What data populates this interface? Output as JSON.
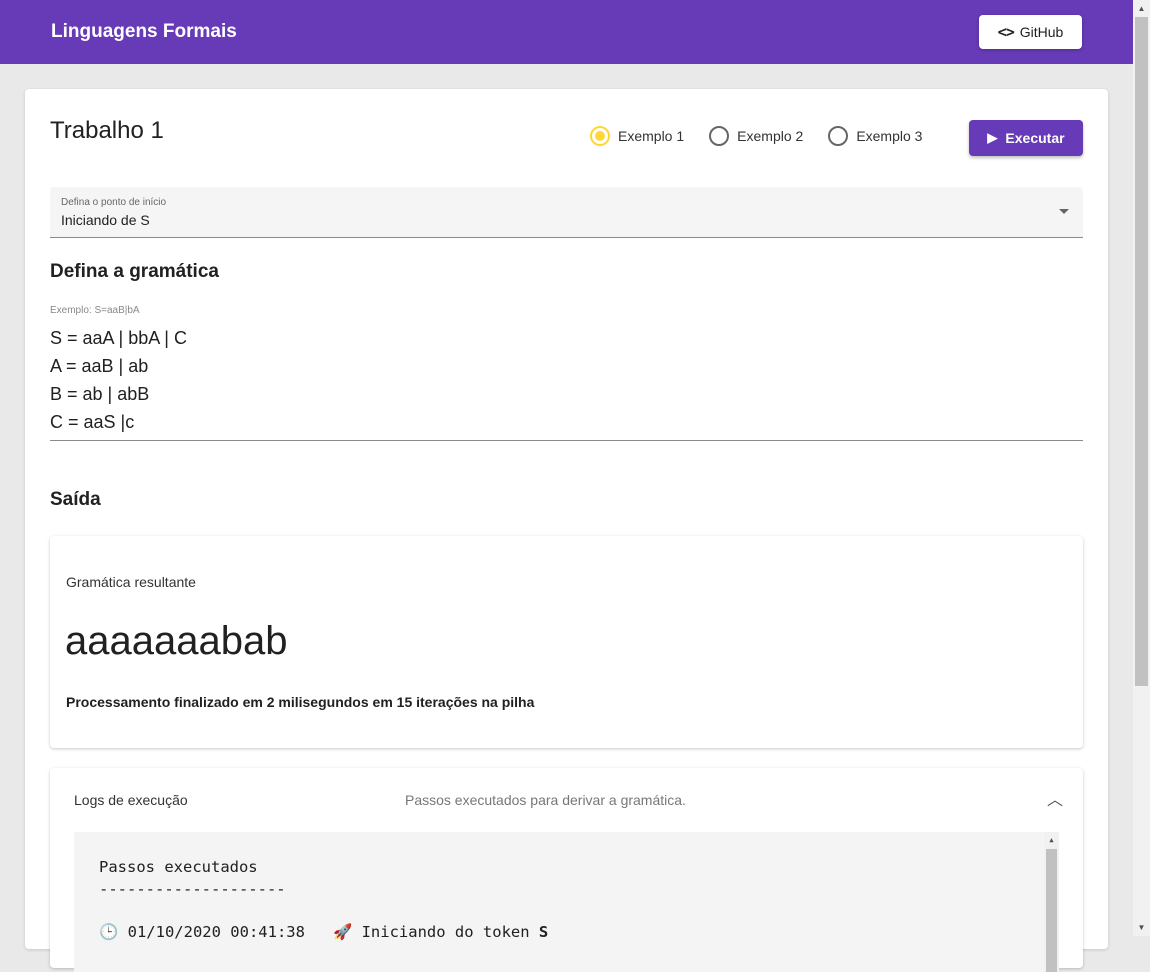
{
  "appbar": {
    "title": "Linguagens Formais",
    "github_label": "GitHub",
    "github_icon": "code-icon"
  },
  "main": {
    "title": "Trabalho 1",
    "examples": [
      {
        "label": "Exemplo 1",
        "checked": true
      },
      {
        "label": "Exemplo 2",
        "checked": false
      },
      {
        "label": "Exemplo 3",
        "checked": false
      }
    ],
    "run_label": "Executar",
    "start_select": {
      "label": "Defina o ponto de início",
      "value": "Iniciando de S"
    },
    "grammar_heading": "Defina a gramática",
    "grammar_hint": "Exemplo: S=aaB|bA",
    "grammar_lines": [
      "S = aaA | bbA | C",
      "A = aaB | ab",
      "B = ab | abB",
      "C = aaS |c"
    ],
    "output_heading": "Saída"
  },
  "result": {
    "label": "Gramática resultante",
    "word": "aaaaaaabab",
    "stats": "Processamento finalizado em 2 milisegundos em 15 iterações na pilha"
  },
  "logs": {
    "title": "Logs de execução",
    "subtitle": "Passos executados para derivar a gramática.",
    "heading": "Passos executados",
    "divider": "--------------------",
    "entry_time": "01/10/2020 00:41:38",
    "entry_text": "Iniciando do token ",
    "entry_token": "S"
  },
  "colors": {
    "primary": "#673ab7",
    "accent": "#fdd835"
  }
}
